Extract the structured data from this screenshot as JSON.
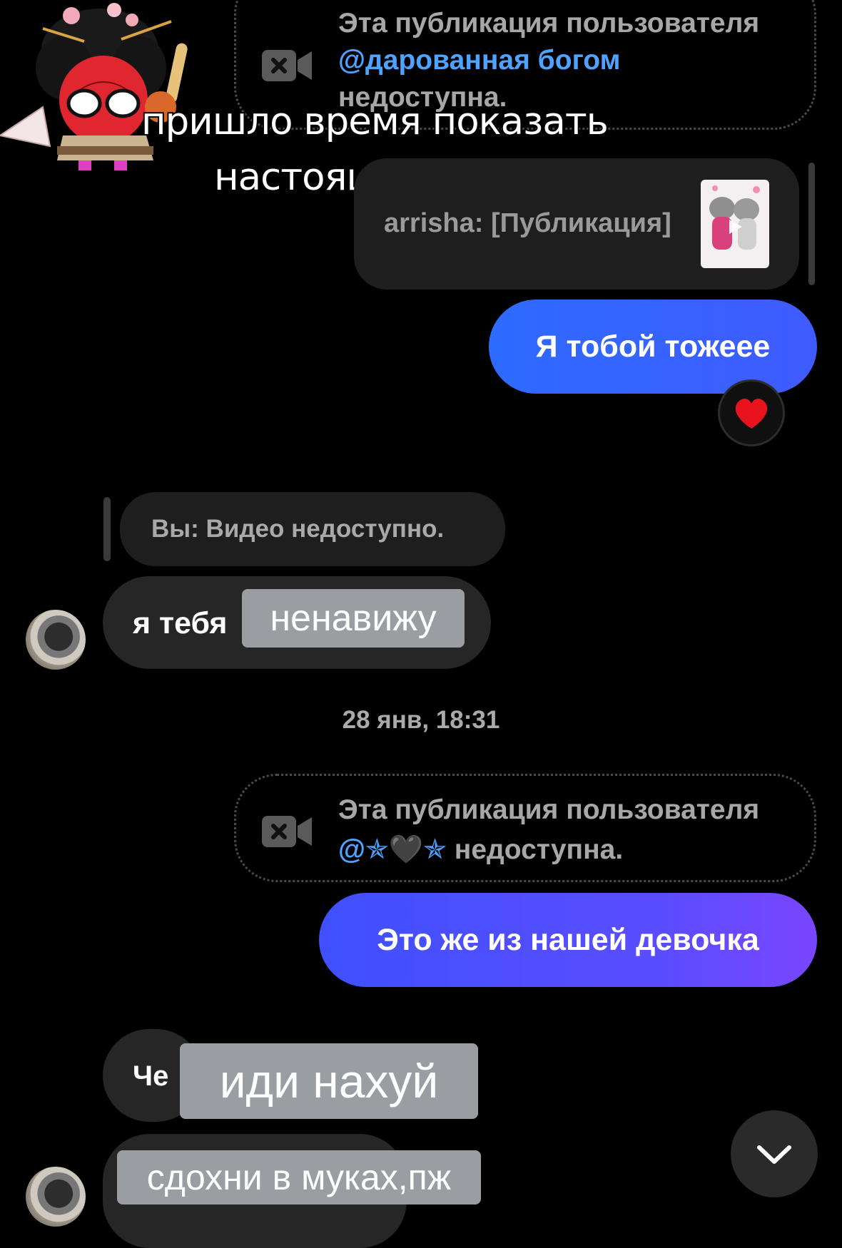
{
  "post_unavailable_1": {
    "text_prefix": "Эта публикация пользователя",
    "mention": "@дарованная богом",
    "suffix": "недоступна."
  },
  "overlay_caption": {
    "line1": "пришло время показать",
    "line2": "настоящую арину"
  },
  "shared_post": {
    "label": "arrisha: [Публикация]"
  },
  "messages": {
    "out_1": "Я тобой тожеее",
    "reaction": "❤️",
    "reply_preview": "Вы: Видео недоступно.",
    "in_1_prefix": "я тебя",
    "in_1_overlay": "ненавижу",
    "out_2": "Это же из нашей девочка",
    "in_2_prefix": "Че",
    "in_2_overlay": "иди нахуй",
    "in_3_overlay": "сдохни в муках,пж"
  },
  "date_separator": "28 янв, 18:31",
  "post_unavailable_2": {
    "text_prefix": "Эта публикация пользователя",
    "mention": "@✯🖤✯",
    "suffix": "недоступна."
  },
  "icons": {
    "video_unavailable": "video-off-icon",
    "scroll_down": "chevron-down-icon"
  },
  "colors": {
    "background": "#000000",
    "outgoing_bubble": "#2d6bff",
    "incoming_bubble": "#262626",
    "mention": "#4da3ff",
    "muted_text": "#a7a7a7"
  }
}
